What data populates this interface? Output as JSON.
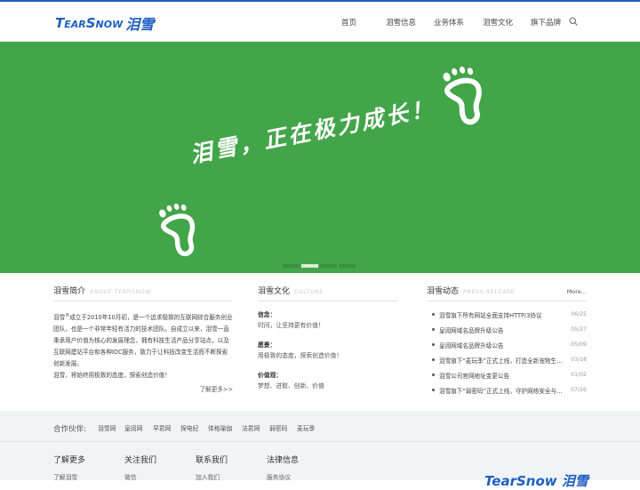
{
  "header": {
    "logo_latin_1": "T",
    "logo_latin_2": "EAR",
    "logo_latin_3": "S",
    "logo_latin_4": "NOW",
    "logo_cjk": "泪雪",
    "nav": [
      "首页",
      "泪雪信息",
      "业务体系",
      "泪雪文化",
      "旗下品牌"
    ],
    "search_icon": "search-icon"
  },
  "banner": {
    "slogan": "泪雪，正在极力成长！",
    "slides": 4,
    "active_slide": 2,
    "background": "#43a549"
  },
  "about": {
    "title": "泪雪简介",
    "subtitle": "ABOUT TEARSNOW",
    "text_1": "泪雪",
    "sup": "®",
    "text_2": "成立于2010年10月初，是一个追求极致的互联网综合服务创业团队，也是一个非常年轻有活力的技术团队。自成立以来，泪雪一直秉承用户价值为核心的发展理念，拥有科技生活产品分享站点，以及互联网建站平台和各种IDC服务，致力于让科技改变生活而不断探索创新发展。",
    "text_3": "泪雪，将始终用极致的态度，探索创造价值！",
    "more": "了解更多>>"
  },
  "culture": {
    "title": "泪雪文化",
    "subtitle": "CULTURE",
    "items": [
      {
        "label": "信念：",
        "value": "时间，让坚持更有价值！"
      },
      {
        "label": "愿景：",
        "value": "用极致的态度，探索创造价值！"
      },
      {
        "label": "价值观：",
        "value": "梦想、进取、创新、价值"
      }
    ]
  },
  "news": {
    "title": "泪雪动态",
    "subtitle": "PRESS RELEASE",
    "more": "More...",
    "items": [
      {
        "title": "泪雪旗下所有网站全面支持HTTP/3协议",
        "date": "06/25"
      },
      {
        "title": "皇阅网域名品牌升级公告",
        "date": "05/27"
      },
      {
        "title": "皇阅网域名品牌升级公告",
        "date": "05/09"
      },
      {
        "title": "泪雪旗下“麦玩季”正式上线，打造全新宠物生…",
        "date": "03/18"
      },
      {
        "title": "泪雪公司官网地址变更公告",
        "date": "01/02"
      },
      {
        "title": "泪雪旗下“弱密码”正式上线，守护网络安全与…",
        "date": "07/26"
      }
    ]
  },
  "partners": {
    "label": "合作伙伴:",
    "items": [
      "泪雪网",
      "皇阅网",
      "早君网",
      "探电纪",
      "体格瑜伽",
      "法君网",
      "弱密码",
      "麦玩季"
    ]
  },
  "footer": {
    "columns": [
      {
        "title": "了解更多",
        "link": "了解泪雪"
      },
      {
        "title": "关注我们",
        "link": "微信"
      },
      {
        "title": "联系我们",
        "link": "加入我们"
      },
      {
        "title": "法律信息",
        "link": "服务协议"
      }
    ],
    "logo_text": "TearSnow 泪雪"
  }
}
